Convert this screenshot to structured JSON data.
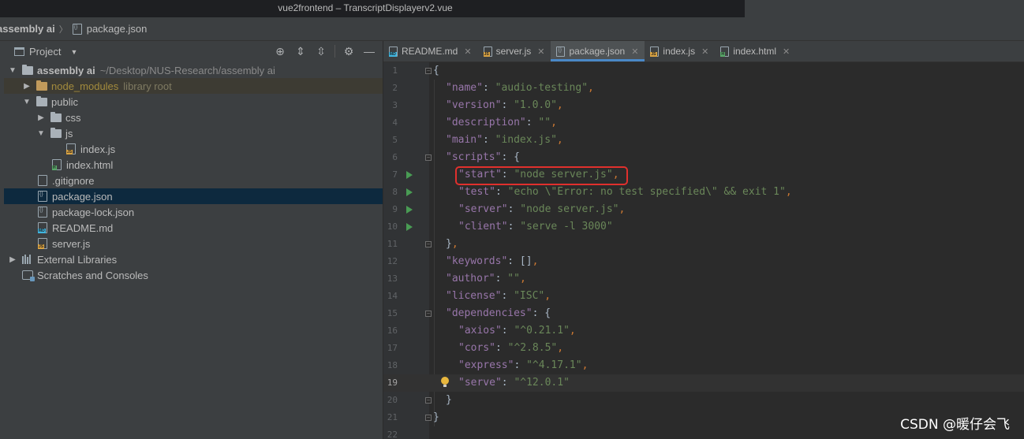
{
  "window": {
    "title": "vue2frontend – TranscriptDisplayerv2.vue"
  },
  "breadcrumb": {
    "root": "assembly ai",
    "file": "package.json"
  },
  "project": {
    "header_label": "Project",
    "tree": [
      {
        "label": "assembly ai",
        "path": "~/Desktop/NUS-Research/assembly ai"
      },
      {
        "label": "node_modules",
        "note": "library root"
      },
      {
        "label": "public"
      },
      {
        "label": "css"
      },
      {
        "label": "js"
      },
      {
        "label": "index.js"
      },
      {
        "label": "index.html"
      },
      {
        "label": ".gitignore"
      },
      {
        "label": "package.json"
      },
      {
        "label": "package-lock.json"
      },
      {
        "label": "README.md"
      },
      {
        "label": "server.js"
      },
      {
        "label": "External Libraries"
      },
      {
        "label": "Scratches and Consoles"
      }
    ]
  },
  "tabs": [
    {
      "label": "README.md",
      "icon": "markdown-file-icon"
    },
    {
      "label": "server.js",
      "icon": "js-file-icon"
    },
    {
      "label": "package.json",
      "icon": "json-file-icon"
    },
    {
      "label": "index.js",
      "icon": "js-file-icon"
    },
    {
      "label": "index.html",
      "icon": "html-file-icon"
    }
  ],
  "editor": {
    "line_numbers": [
      "1",
      "2",
      "3",
      "4",
      "5",
      "6",
      "7",
      "8",
      "9",
      "10",
      "11",
      "12",
      "13",
      "14",
      "15",
      "16",
      "17",
      "18",
      "19",
      "20",
      "21",
      "22"
    ],
    "current_line": "19",
    "lines": {
      "l1": "{",
      "l2_key": "\"name\"",
      "l2_val": "\"audio-testing\"",
      "l3_key": "\"version\"",
      "l3_val": "\"1.0.0\"",
      "l4_key": "\"description\"",
      "l4_val": "\"\"",
      "l5_key": "\"main\"",
      "l5_val": "\"index.js\"",
      "l6_key": "\"scripts\"",
      "l7_key": "\"start\"",
      "l7_val": "\"node server.js\"",
      "l8_key": "\"test\"",
      "l8_val": "\"echo \\\"Error: no test specified\\\" && exit 1\"",
      "l9_key": "\"server\"",
      "l9_val": "\"node server.js\"",
      "l10_key": "\"client\"",
      "l10_val": "\"serve -l 3000\"",
      "l12_key": "\"keywords\"",
      "l13_key": "\"author\"",
      "l13_val": "\"\"",
      "l14_key": "\"license\"",
      "l14_val": "\"ISC\"",
      "l15_key": "\"dependencies\"",
      "l16_key": "\"axios\"",
      "l16_val": "\"^0.21.1\"",
      "l17_key": "\"cors\"",
      "l17_val": "\"^2.8.5\"",
      "l18_key": "\"express\"",
      "l18_val": "\"^4.17.1\"",
      "l19_key": "\"serve\"",
      "l19_val": "\"^12.0.1\""
    }
  },
  "watermark": "CSDN @暖仔会飞",
  "colors": {
    "key": "#9876aa",
    "string": "#6a8759",
    "punct": "#cc7832",
    "highlight": "#e0302d"
  }
}
